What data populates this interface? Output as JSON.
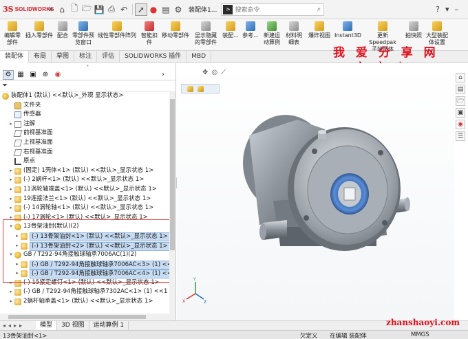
{
  "app": {
    "logo_ds": "3S",
    "logo_text": "SOLIDWORKS",
    "doc_title": "装配体1...",
    "search_placeholder": "搜索命令"
  },
  "ribbon": [
    {
      "label": "编辑零\n部件",
      "color": "y"
    },
    {
      "label": "插入零部件",
      "color": "y"
    },
    {
      "label": "配合",
      "color": "gr"
    },
    {
      "label": "零部件预\n览窗口",
      "color": "b"
    },
    {
      "label": "线性零部件阵列",
      "color": "y"
    },
    {
      "label": "智能扣\n件",
      "color": "r"
    },
    {
      "label": "移动零部件",
      "color": "y"
    },
    {
      "label": "显示隐藏\n的零部件",
      "color": "gr"
    },
    {
      "label": "装配...",
      "color": "y"
    },
    {
      "label": "参考...",
      "color": "b"
    },
    {
      "label": "新建运\n动算例",
      "color": "g"
    },
    {
      "label": "材料明\n细表",
      "color": "gr"
    },
    {
      "label": "爆炸视图",
      "color": "y"
    },
    {
      "label": "Instant3D",
      "color": "b"
    },
    {
      "label": "更新 Speedpak\n子装配体",
      "color": "y"
    },
    {
      "label": "拍快照",
      "color": "gr"
    },
    {
      "label": "大型装配\n体设置",
      "color": "y"
    }
  ],
  "tabs": [
    "装配体",
    "布局",
    "草图",
    "标注",
    "评估",
    "SOLIDWORKS 插件",
    "MBD"
  ],
  "active_tab": "装配体",
  "watermark": {
    "cn": "我 爱 分 享 网",
    "url": "www.zhanshaoyi.com",
    "footer": "zhanshaoyi.com"
  },
  "tree": {
    "root": "装配体1 (默认) <<默认>_外观 显示状态>",
    "nodes": [
      {
        "text": "文件夹",
        "icon": "fold",
        "level": 1,
        "exp": ""
      },
      {
        "text": "传感器",
        "icon": "sens",
        "level": 1,
        "exp": ""
      },
      {
        "text": "注解",
        "icon": "note",
        "level": 1,
        "exp": "▸"
      },
      {
        "text": "前视基准面",
        "icon": "plane",
        "level": 1,
        "exp": ""
      },
      {
        "text": "上视基准面",
        "icon": "plane",
        "level": 1,
        "exp": ""
      },
      {
        "text": "右视基准面",
        "icon": "plane",
        "level": 1,
        "exp": ""
      },
      {
        "text": "原点",
        "icon": "orig",
        "level": 1,
        "exp": ""
      },
      {
        "text": "(固定) 1壳体<1> (默认) <<默认>_显示状态 1>",
        "icon": "part",
        "level": 1,
        "exp": "▸"
      },
      {
        "text": "(-) 2蜗杆<1> (默认) <<默认>_显示状态 1>",
        "icon": "part",
        "level": 1,
        "exp": "▸"
      },
      {
        "text": "11涡轮轴端盖<1> (默认) <<默认>_显示状态 1>",
        "icon": "part",
        "level": 1,
        "exp": "▸"
      },
      {
        "text": "19连接法兰<1> (默认) <<默认>_显示状态 1>",
        "icon": "part",
        "level": 1,
        "exp": "▸"
      },
      {
        "text": "(-) 14涡轮轴<1> (默认) <<默认>_显示状态 1>",
        "icon": "part",
        "level": 1,
        "exp": "▸"
      },
      {
        "text": "(-) 17涡轮<1> (默认) <<默认>_显示状态 1>",
        "icon": "part",
        "level": 1,
        "exp": "▸"
      },
      {
        "text": "13骨架油封(默认)(2)",
        "icon": "asm",
        "level": 1,
        "exp": "▾"
      },
      {
        "text": "(-) 13骨架油封<1> (默认) <<默认>_显示状态 1>",
        "icon": "part",
        "level": 2,
        "exp": "▸",
        "hl": true
      },
      {
        "text": "(-) 13骨架油封<2> (默认) <<默认>_显示状态 1>",
        "icon": "part",
        "level": 2,
        "exp": "▸",
        "hl": true
      },
      {
        "text": "GB / T292-94角接触球轴承7006AC(1)(2)",
        "icon": "asm",
        "level": 1,
        "exp": "▾"
      },
      {
        "text": "(-) GB / T292-94角接触球轴承7006AC<3> (1) <<1",
        "icon": "part",
        "level": 2,
        "exp": "▸",
        "hl": true
      },
      {
        "text": "(-) GB / T292-94角接触球轴承7006AC<4> (1) <<1",
        "icon": "part",
        "level": 2,
        "exp": "▸",
        "hl": true
      },
      {
        "text": "(-) 15紧定螺钉<1> (默认) <<默认>_显示状态 1>",
        "icon": "part",
        "level": 1,
        "exp": "▸"
      },
      {
        "text": "(-) GB / T292-94角接触球轴承7302AC<1> (1) <<1",
        "icon": "part",
        "level": 1,
        "exp": "▸"
      },
      {
        "text": "2蜗杆轴承盖<1> (默认) <<默认>_显示状态 1>",
        "icon": "part",
        "level": 1,
        "exp": "▸"
      }
    ]
  },
  "bottom_tabs": [
    "模型",
    "3D 视图",
    "运动算例 1"
  ],
  "status": {
    "left": "13骨架油封<1>",
    "s1": "欠定义",
    "s2": "在编辑 装配体",
    "units": "MMGS"
  }
}
